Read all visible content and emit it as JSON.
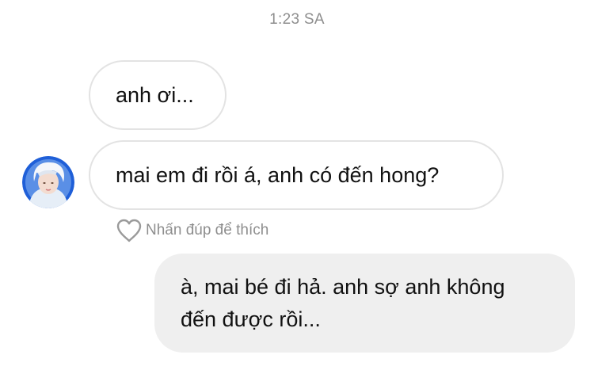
{
  "timestamp": "1:23 SA",
  "messages": [
    {
      "sender": "other",
      "text": "anh ơi..."
    },
    {
      "sender": "other",
      "text": "mai em đi rồi á, anh có đến hong?"
    },
    {
      "sender": "me",
      "lines": [
        "à, mai bé đi hả. anh sợ anh không",
        "đến được rồi..."
      ]
    }
  ],
  "like_hint": "Nhấn đúp để thích",
  "icons": {
    "avatar": "avatar",
    "like": "heart-icon"
  },
  "colors": {
    "incoming_bubble_border": "#e3e3e3",
    "outgoing_bubble_bg": "#efefef",
    "meta_text": "#8e8e8e",
    "avatar_ring": "#1f5fd8"
  }
}
